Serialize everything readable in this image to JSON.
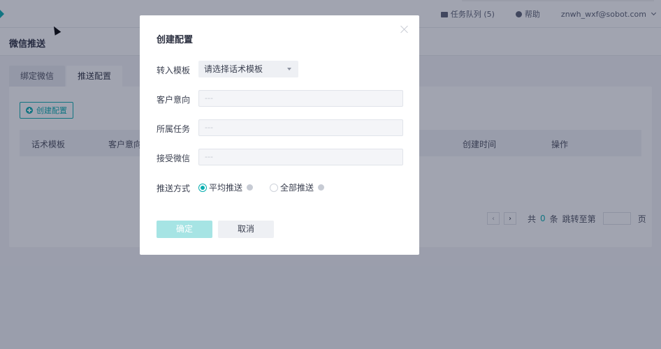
{
  "topbar": {
    "task_queue_label": "任务队列 (5)",
    "help_label": "帮助",
    "user_email": "znwh_wxf@sobot.com"
  },
  "page": {
    "title": "微信推送"
  },
  "tabs": [
    {
      "label": "绑定微信"
    },
    {
      "label": "推送配置"
    }
  ],
  "panel": {
    "create_button_label": "创建配置",
    "table_headers": [
      "话术模板",
      "客户意向",
      "创建时间",
      "操作"
    ]
  },
  "pager": {
    "total_prefix": "共",
    "total_count": "0",
    "total_suffix": "条",
    "jump_label": "跳转至第",
    "page_suffix": "页"
  },
  "modal": {
    "title": "创建配置",
    "fields": {
      "template_label": "转入模板",
      "template_value": "请选择话术模板",
      "intent_label": "客户意向",
      "intent_value": "---",
      "task_label": "所属任务",
      "task_value": "---",
      "wechat_label": "接受微信",
      "wechat_value": "---",
      "push_method_label": "推送方式",
      "push_options": [
        {
          "label": "平均推送",
          "checked": true
        },
        {
          "label": "全部推送",
          "checked": false
        }
      ]
    },
    "confirm_label": "确定",
    "cancel_label": "取消"
  },
  "colors": {
    "accent": "#09aeb0",
    "accent_disabled": "#a6e4e4",
    "mask": "rgba(30,37,66,0.42)"
  }
}
